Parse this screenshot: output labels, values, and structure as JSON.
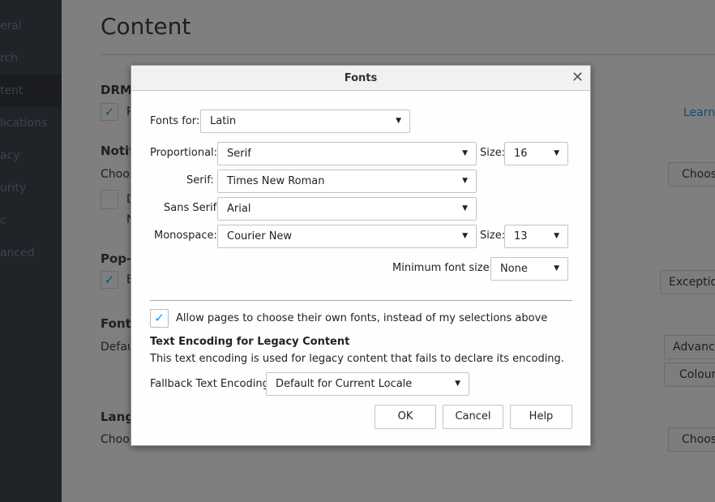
{
  "sidebar": {
    "items": [
      {
        "label": "eral"
      },
      {
        "label": "rch"
      },
      {
        "label": "tent",
        "active": true
      },
      {
        "label": "lications"
      },
      {
        "label": "acy"
      },
      {
        "label": "urity"
      },
      {
        "label": "c"
      },
      {
        "label": "anced"
      }
    ]
  },
  "page": {
    "title": "Content",
    "drm_heading": "DRM",
    "drm_checkbox_label": "P",
    "learn_more": "Learn",
    "notif_heading": "Notif",
    "notif_text": "Choos",
    "notif_cb_label": "D",
    "notif_cb_sub": "N",
    "notif_choose": "Choos",
    "popup_heading": "Pop-",
    "popup_cb_label": "B",
    "popup_exceptions": "Exceptio",
    "fonts_heading": "Fonts",
    "fonts_default": "Defau",
    "fonts_advanced": "Advance",
    "fonts_colours": "Colour",
    "lang_heading": "Lang",
    "lang_text": "Choos",
    "lang_choose": "Choos"
  },
  "dialog": {
    "title": "Fonts",
    "fonts_for_label": "Fonts for:",
    "fonts_for_value": "Latin",
    "proportional_label": "Proportional:",
    "proportional_value": "Serif",
    "size_label": "Size:",
    "proportional_size": "16",
    "serif_label": "Serif:",
    "serif_value": "Times New Roman",
    "sans_label": "Sans Serif:",
    "sans_value": "Arial",
    "mono_label": "Monospace:",
    "mono_value": "Courier New",
    "mono_size": "13",
    "min_size_label": "Minimum font size:",
    "min_size_value": "None",
    "allow_label": "Allow pages to choose their own fonts, instead of my selections above",
    "allow_checked": true,
    "encoding_heading": "Text Encoding for Legacy Content",
    "encoding_desc": "This text encoding is used for legacy content that fails to declare its encoding.",
    "fallback_label": "Fallback Text Encoding:",
    "fallback_value": "Default for Current Locale",
    "ok": "OK",
    "cancel": "Cancel",
    "help": "Help"
  },
  "colors": {
    "accent": "#0996f8",
    "link": "#0a4f7a"
  }
}
